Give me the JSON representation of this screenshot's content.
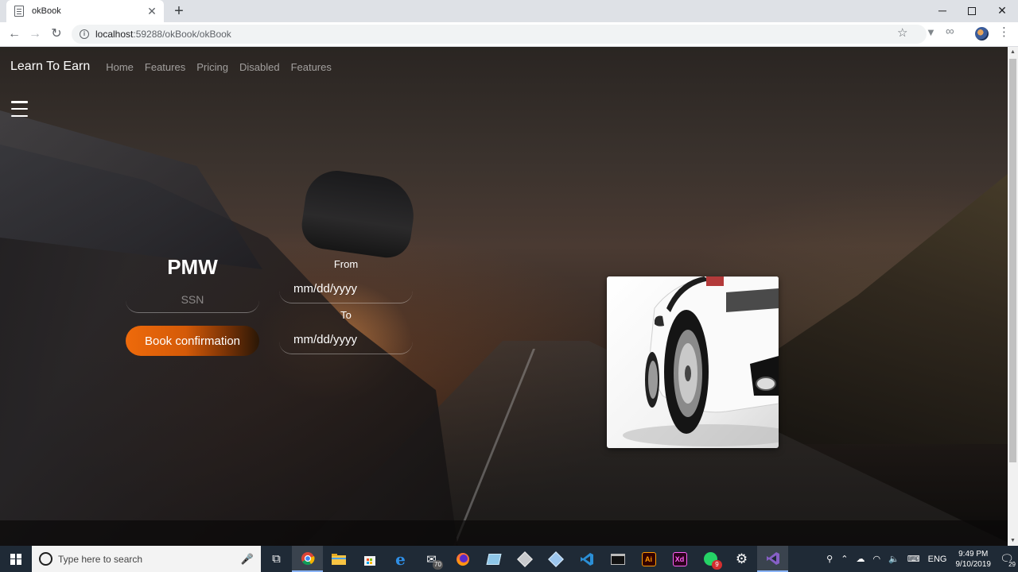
{
  "browser": {
    "tab_title": "okBook",
    "tab_close_glyph": "✕",
    "new_tab_glyph": "+",
    "url_host": "localhost",
    "url_path": ":59288/okBook/okBook",
    "window_controls": {
      "minimize": "─",
      "close": "✕"
    }
  },
  "page": {
    "brand": "Learn To Earn",
    "nav_links": [
      "Home",
      "Features",
      "Pricing",
      "Disabled",
      "Features"
    ],
    "menu_icon": "hamburger-icon",
    "booking": {
      "car_name": "PMW",
      "ssn_placeholder": "SSN",
      "book_button_label": "Book confirmation",
      "from_label": "From",
      "from_placeholder": "mm/dd/yyyy",
      "to_label": "To",
      "to_placeholder": "mm/dd/yyyy"
    },
    "accent_color": "#ee6a0b"
  },
  "taskbar": {
    "search_placeholder": "Type here to search",
    "mail_badge": "70",
    "whatsapp_badge": "9",
    "adobe_illustrator_label": "Ai",
    "adobe_xd_label": "Xd",
    "language": "ENG",
    "time": "9:49 PM",
    "date": "9/10/2019",
    "notification_count": "29"
  }
}
